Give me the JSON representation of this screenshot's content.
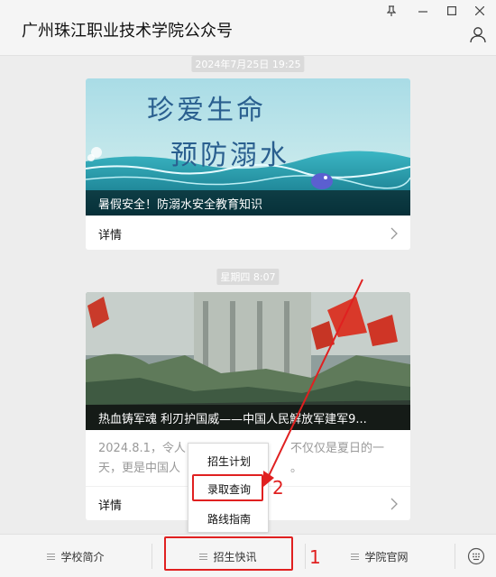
{
  "window": {
    "title": "广州珠江职业技术学院公众号",
    "controls": {
      "pin": "pin-icon",
      "minimize": "minimize-icon",
      "maximize": "maximize-icon",
      "close": "close-icon"
    }
  },
  "feed": [
    {
      "timestamp": "2024年7月25日 19:25",
      "cover_title_line1": "珍爱生命",
      "cover_title_line2": "预防溺水",
      "caption": "暑假安全！防溺水安全教育知识",
      "detail_label": "详情"
    },
    {
      "timestamp": "星期四 8:07",
      "caption": "热血铸军魂 利刃护国威——中国人民解放军建军9...",
      "summary_left": "2024.8.1，令人",
      "summary_right": "不仅仅是夏日的一",
      "summary_line2_left": "天，更是中国人",
      "summary_line2_right": "。",
      "detail_label": "详情"
    }
  ],
  "popup_menu": {
    "items": [
      "招生计划",
      "录取查询",
      "路线指南"
    ],
    "highlighted_index": 1
  },
  "bottom_menu": {
    "items": [
      "学校简介",
      "招生快讯",
      "学院官网"
    ],
    "keyboard_icon": "keyboard-icon"
  },
  "annotations": {
    "label_1": "1",
    "label_2": "2",
    "color": "#e02020"
  }
}
